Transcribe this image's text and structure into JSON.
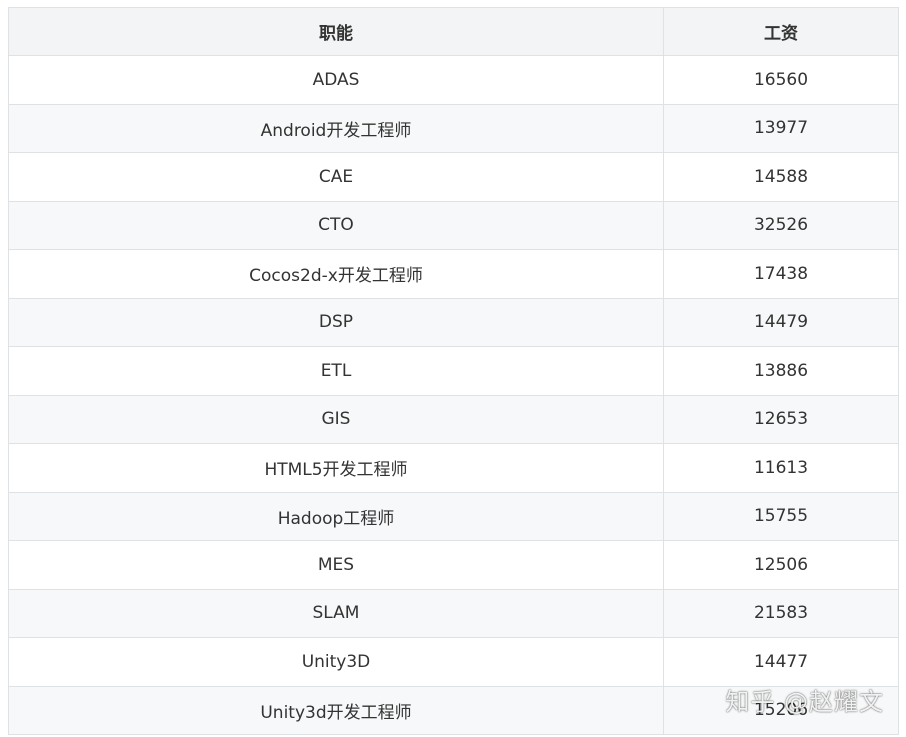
{
  "table": {
    "headers": [
      "职能",
      "工资"
    ],
    "rows": [
      [
        "ADAS",
        "16560"
      ],
      [
        "Android开发工程师",
        "13977"
      ],
      [
        "CAE",
        "14588"
      ],
      [
        "CTO",
        "32526"
      ],
      [
        "Cocos2d-x开发工程师",
        "17438"
      ],
      [
        "DSP",
        "14479"
      ],
      [
        "ETL",
        "13886"
      ],
      [
        "GIS",
        "12653"
      ],
      [
        "HTML5开发工程师",
        "11613"
      ],
      [
        "Hadoop工程师",
        "15755"
      ],
      [
        "MES",
        "12506"
      ],
      [
        "SLAM",
        "21583"
      ],
      [
        "Unity3D",
        "14477"
      ],
      [
        "Unity3d开发工程师",
        "15206"
      ]
    ]
  },
  "watermark": {
    "text": "知乎 @赵耀文"
  }
}
